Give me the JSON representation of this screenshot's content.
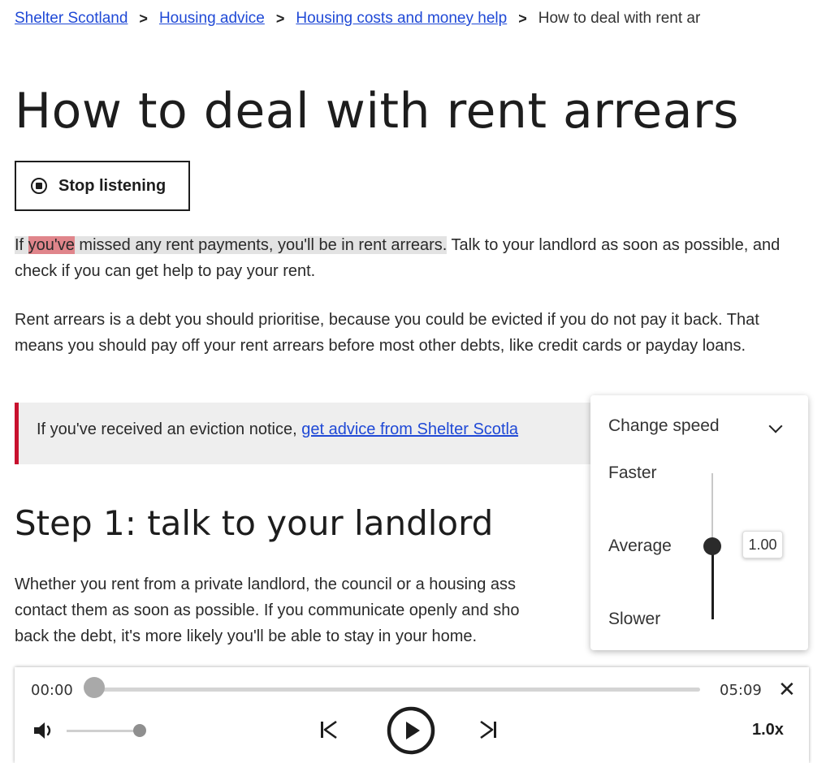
{
  "breadcrumb": {
    "items": [
      "Shelter Scotland",
      "Housing advice",
      "Housing costs and money help"
    ],
    "current": "How to deal with rent ar"
  },
  "page_title": "How to deal with rent arrears",
  "stop_button_label": "Stop listening",
  "paragraph1": {
    "pre": "If ",
    "highlight_word": "you've",
    "sentence_rest": " missed any rent payments, you'll be in rent arrears.",
    "tail": " Talk to your landlord as soon as possible, and check if you can get help to pay your rent."
  },
  "paragraph2": "Rent arrears is a debt you should prioritise, because you could be evicted if you do not pay it back. That means you should pay off your rent arrears before most other debts, like credit cards or payday loans.",
  "callout": {
    "text": "If you've received an eviction notice, ",
    "link": "get advice from Shelter Scotla"
  },
  "step1_heading": "Step 1: talk to your landlord",
  "paragraph3_lines": [
    "Whether you rent from a private landlord, the council or a housing ass",
    "contact them as soon as possible. If you communicate openly and sho",
    "back the debt, it's more likely you'll be able to stay in your home."
  ],
  "speed_panel": {
    "title": "Change speed",
    "faster": "Faster",
    "average": "Average",
    "slower": "Slower",
    "value": "1.00",
    "level": 0.5
  },
  "player": {
    "current_time": "00:00",
    "duration": "05:09",
    "progress": 0.0,
    "volume": 1.0,
    "rate_label": "1.0x",
    "close_icon": "close-icon"
  },
  "colors": {
    "link": "#1f49d6",
    "callout_border": "#c8102e",
    "word_highlight": "#e0858b",
    "sentence_highlight": "#e3e3e3"
  }
}
